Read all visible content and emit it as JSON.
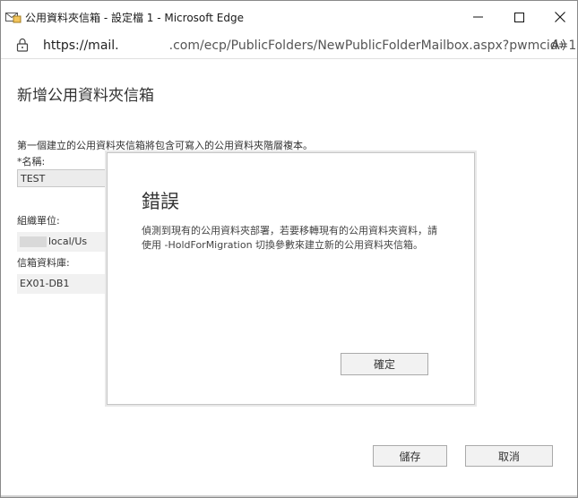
{
  "window": {
    "title": "公用資料夾信箱 - 設定檔 1 - Microsoft Edge",
    "icon": "mail-folder-icon",
    "controls": {
      "minimize": "minimize-icon",
      "maximize": "maximize-icon",
      "close": "close-icon"
    }
  },
  "addressbar": {
    "url_prefix": "https://mail.",
    "url_suffix": ".com/ecp/PublicFolders/NewPublicFolderMailbox.aspx?pwmcid=1...",
    "read_aloud_icon": "A"
  },
  "page": {
    "title": "新增公用資料夾信箱",
    "intro": "第一個建立的公用資料夾信箱將包含可寫入的公用資料夾階層複本。",
    "name_label": "*名稱:",
    "name_value": "TEST",
    "ou_label": "組織單位:",
    "ou_value": "local/Us",
    "db_label": "信箱資料庫:",
    "db_value": "EX01-DB1",
    "save_label": "儲存",
    "cancel_label": "取消"
  },
  "dialog": {
    "title": "錯誤",
    "message": "偵測到現有的公用資料夾部署，若要移轉現有的公用資料夾資料，請使用 -HoldForMigration 切換參數來建立新的公用資料夾信箱。",
    "ok_label": "確定"
  }
}
